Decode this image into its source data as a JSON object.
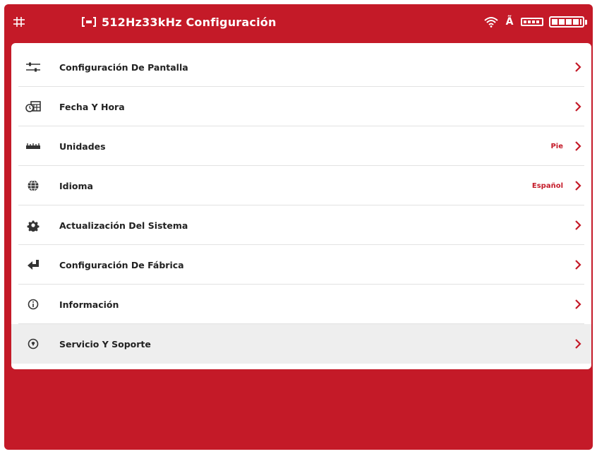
{
  "status_bar": {
    "title": "512Hz33kHz Configuración",
    "icons": [
      "grid-logo-icon",
      "signal-bracket-icon",
      "wifi-icon",
      "a-glyph-icon",
      "battery-small-icon",
      "battery-large-icon"
    ],
    "a_glyph": "Ã"
  },
  "menu": {
    "items": [
      {
        "icon": "sliders-icon",
        "label": "Configuración De Pantalla",
        "value": ""
      },
      {
        "icon": "calendar-clock-icon",
        "label": "Fecha Y Hora",
        "value": ""
      },
      {
        "icon": "ruler-icon",
        "label": "Unidades",
        "value": "Pie"
      },
      {
        "icon": "globe-icon",
        "label": "Idioma",
        "value": "Español"
      },
      {
        "icon": "gear-icon",
        "label": "Actualización Del Sistema",
        "value": ""
      },
      {
        "icon": "reset-arrow-icon",
        "label": "Configuración De Fábrica",
        "value": ""
      },
      {
        "icon": "info-icon",
        "label": "Información",
        "value": ""
      },
      {
        "icon": "support-icon",
        "label": "Servicio Y Soporte",
        "value": ""
      }
    ],
    "highlighted_index": 7
  },
  "colors": {
    "accent": "#c41a28",
    "panel": "#ffffff",
    "highlight": "#eeeeee",
    "text": "#222222"
  }
}
